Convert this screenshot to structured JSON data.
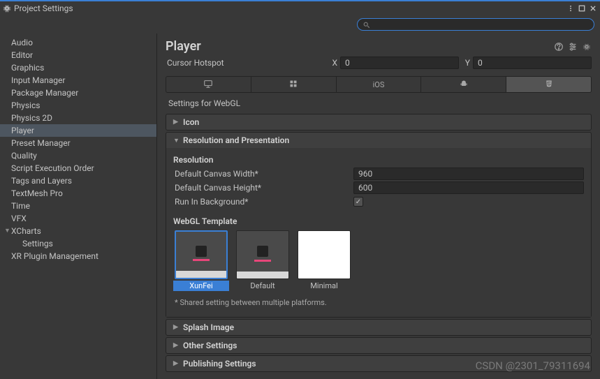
{
  "window": {
    "title": "Project Settings"
  },
  "search": {
    "placeholder": ""
  },
  "sidebar": {
    "items": [
      {
        "label": "Audio"
      },
      {
        "label": "Editor"
      },
      {
        "label": "Graphics"
      },
      {
        "label": "Input Manager"
      },
      {
        "label": "Package Manager"
      },
      {
        "label": "Physics"
      },
      {
        "label": "Physics 2D"
      },
      {
        "label": "Player",
        "selected": true
      },
      {
        "label": "Preset Manager"
      },
      {
        "label": "Quality"
      },
      {
        "label": "Script Execution Order"
      },
      {
        "label": "Tags and Layers"
      },
      {
        "label": "TextMesh Pro"
      },
      {
        "label": "Time"
      },
      {
        "label": "VFX"
      },
      {
        "label": "XCharts",
        "arrow": true
      },
      {
        "label": "Settings",
        "nested": true
      },
      {
        "label": "XR Plugin Management"
      }
    ]
  },
  "content": {
    "title": "Player",
    "cursor_hotspot_label": "Cursor Hotspot",
    "cursor_x_label": "X",
    "cursor_x_value": "0",
    "cursor_y_label": "Y",
    "cursor_y_value": "0",
    "platform_tabs": [
      {
        "name": "standalone"
      },
      {
        "name": "windows"
      },
      {
        "name": "ios",
        "label": "iOS"
      },
      {
        "name": "android"
      },
      {
        "name": "webgl",
        "selected": true
      }
    ],
    "settings_for_label": "Settings for WebGL",
    "sections": {
      "icon": {
        "label": "Icon",
        "expanded": false
      },
      "resolution": {
        "label": "Resolution and Presentation",
        "expanded": true,
        "resolution_header": "Resolution",
        "canvas_width_label": "Default Canvas Width*",
        "canvas_width_value": "960",
        "canvas_height_label": "Default Canvas Height*",
        "canvas_height_value": "600",
        "run_bg_label": "Run In Background*",
        "run_bg_checked": true,
        "template_header": "WebGL Template",
        "templates": [
          {
            "label": "XunFei",
            "selected": true
          },
          {
            "label": "Default"
          },
          {
            "label": "Minimal",
            "minimal": true
          }
        ],
        "footnote": "* Shared setting between multiple platforms."
      },
      "splash": {
        "label": "Splash Image",
        "expanded": false
      },
      "other": {
        "label": "Other Settings",
        "expanded": false
      },
      "publishing": {
        "label": "Publishing Settings",
        "expanded": false
      }
    }
  },
  "watermark": "CSDN @2301_79311694"
}
